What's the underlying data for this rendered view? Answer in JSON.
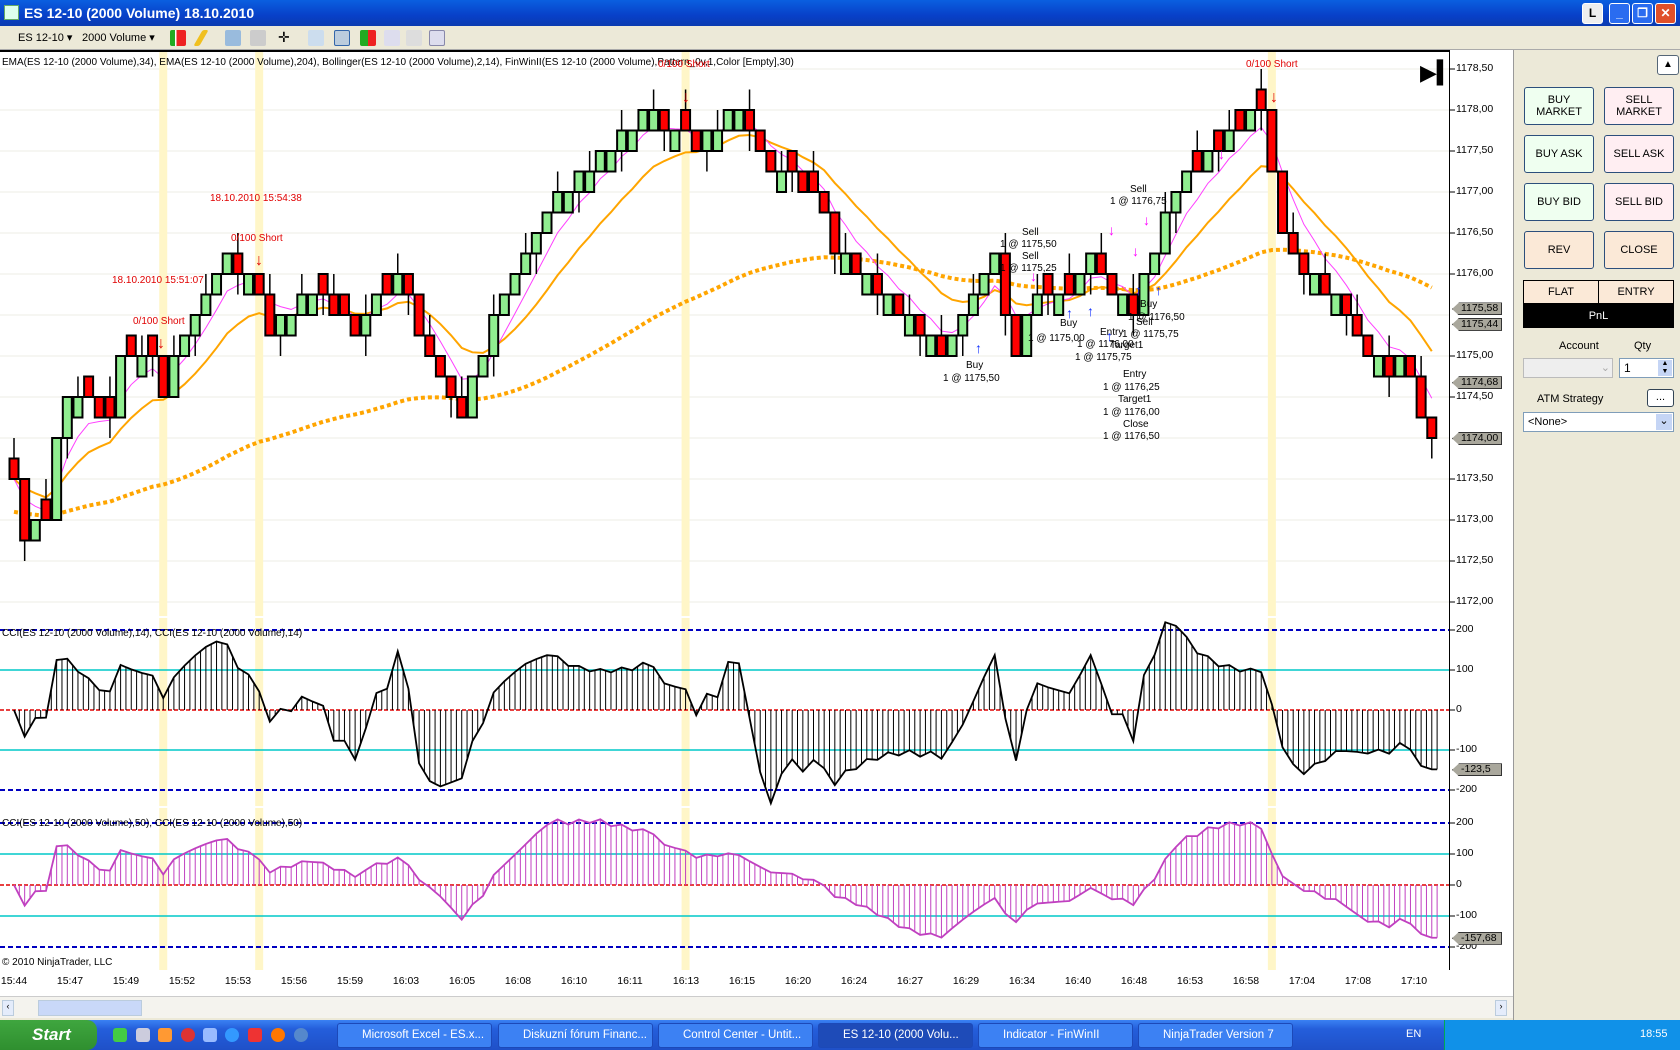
{
  "window": {
    "title": "ES 12-10 (2000 Volume)  18.10.2010",
    "min": "_",
    "restore": "❐",
    "close": "✕",
    "extra": "L"
  },
  "toolbar": {
    "instrument": "ES 12-10",
    "period": "2000 Volume"
  },
  "chart": {
    "indicator_label": "EMA(ES 12-10 (2000 Volume),34), EMA(ES 12-10 (2000 Volume),204), Bollinger(ES 12-10 (2000 Volume),2,14), FinWinII(ES 12-10 (2000 Volume),Pattern_0v,1,Color [Empty],30)",
    "cci1_label": "CCI(ES 12-10 (2000 Volume),14), CCI(ES 12-10 (2000 Volume),14)",
    "cci2_label": "CCI(ES 12-10 (2000 Volume),50), CCI(ES 12-10 (2000 Volume),50)",
    "copyright": "© 2010 NinjaTrader, LLC",
    "price_ticks": [
      "1178,50",
      "1178,00",
      "1177,50",
      "1177,00",
      "1176,50",
      "1176,00",
      "1175,00",
      "1174,50",
      "1173,50",
      "1173,00",
      "1172,50",
      "1172,00"
    ],
    "price_tags": [
      "1175,58",
      "1175,44",
      "1174,68",
      "1174,00"
    ],
    "cci1_ticks": [
      "200",
      "100",
      "0",
      "-100",
      "-200"
    ],
    "cci1_tag": "-123,5",
    "cci2_ticks": [
      "200",
      "100",
      "0",
      "-100",
      "-200"
    ],
    "cci2_tag": "-157,68",
    "time_ticks": [
      "15:44",
      "15:47",
      "15:49",
      "15:52",
      "15:53",
      "15:56",
      "15:59",
      "16:03",
      "16:05",
      "16:08",
      "16:10",
      "16:11",
      "16:13",
      "16:15",
      "16:20",
      "16:24",
      "16:27",
      "16:29",
      "16:34",
      "16:40",
      "16:48",
      "16:53",
      "16:58",
      "17:04",
      "17:08",
      "17:10"
    ],
    "signals": [
      "18.10.2010 15:54:38",
      "0/100 Short",
      "18.10.2010 15:51:07",
      "0/100 Short",
      "0/100 Short",
      "0/100 Short"
    ],
    "trades": [
      "Buy",
      "1 @ 1175,50",
      "Sell",
      "1 @ 1175,50",
      "Sell",
      "1 @ 1175,25",
      "Buy",
      "1 @ 1175,00",
      "Entry",
      "1 @ 1176,00",
      "Target1",
      "1 @ 1175,75",
      "Entry",
      "1 @ 1176,25",
      "Target1",
      "1 @ 1176,00",
      "Close",
      "1 @ 1176,50",
      "Buy",
      "1 @ 1176,50",
      "Sell",
      "1 @ 1175,75",
      "Sell",
      "1 @ 1176,75"
    ]
  },
  "chart_data": {
    "type": "candlestick",
    "price_path": [
      [
        0,
        1173.5
      ],
      [
        1,
        1172.75
      ],
      [
        3,
        1173.0
      ],
      [
        4,
        1174.0
      ],
      [
        5,
        1174.5
      ],
      [
        9,
        1174.25
      ],
      [
        10,
        1175.0
      ],
      [
        13,
        1175.0
      ],
      [
        14,
        1174.5
      ],
      [
        15,
        1175.0
      ],
      [
        18,
        1175.75
      ],
      [
        20,
        1176.25
      ],
      [
        23,
        1175.75
      ],
      [
        24,
        1175.25
      ],
      [
        28,
        1175.75
      ],
      [
        32,
        1175.25
      ],
      [
        36,
        1176.0
      ],
      [
        38,
        1175.25
      ],
      [
        41,
        1174.5
      ],
      [
        42,
        1174.25
      ],
      [
        43,
        1174.75
      ],
      [
        46,
        1175.75
      ],
      [
        49,
        1176.5
      ],
      [
        53,
        1177.25
      ],
      [
        58,
        1177.75
      ],
      [
        59,
        1178.0
      ],
      [
        61,
        1177.75
      ],
      [
        63,
        1177.75
      ],
      [
        64,
        1177.5
      ],
      [
        68,
        1178.0
      ],
      [
        69,
        1177.75
      ],
      [
        71,
        1177.25
      ],
      [
        75,
        1177.0
      ],
      [
        77,
        1176.25
      ],
      [
        81,
        1175.75
      ],
      [
        85,
        1175.25
      ],
      [
        87,
        1175.0
      ],
      [
        89,
        1175.5
      ],
      [
        92,
        1176.25
      ],
      [
        93,
        1175.5
      ],
      [
        94,
        1175.0
      ],
      [
        96,
        1175.75
      ],
      [
        99,
        1175.75
      ],
      [
        101,
        1176.25
      ],
      [
        103,
        1175.75
      ],
      [
        105,
        1175.5
      ],
      [
        107,
        1176.25
      ],
      [
        109,
        1177.0
      ],
      [
        111,
        1177.25
      ],
      [
        115,
        1177.75
      ],
      [
        117,
        1178.0
      ],
      [
        118,
        1177.25
      ],
      [
        119,
        1176.5
      ],
      [
        121,
        1176.0
      ],
      [
        125,
        1175.5
      ],
      [
        127,
        1175.0
      ],
      [
        129,
        1174.75
      ],
      [
        130,
        1175.0
      ],
      [
        133,
        1174.0
      ]
    ],
    "ylim": [
      1171.875,
      1178.6
    ],
    "colors": {
      "up": "#90ee90",
      "down": "#ff0000",
      "ema_fast": "#ff40ff",
      "ema34": "#ffa500",
      "ema204": "#ffa500",
      "cci2": "#c040c0"
    }
  },
  "panel": {
    "buy_market": "BUY MARKET",
    "sell_market": "SELL MARKET",
    "buy_ask": "BUY ASK",
    "sell_ask": "SELL ASK",
    "buy_bid": "BUY BID",
    "sell_bid": "SELL BID",
    "rev": "REV",
    "close": "CLOSE",
    "flat": "FLAT",
    "entry": "ENTRY",
    "pnl": "PnL",
    "account_label": "Account",
    "qty_label": "Qty",
    "qty": "1",
    "atm_label": "ATM Strategy",
    "atm_btn": "...",
    "atm_value": "<None>"
  },
  "taskbar": {
    "start": "Start",
    "tasks": [
      "Microsoft Excel - ES.x...",
      "Diskuzní fórum Financ...",
      "Control Center - Untit...",
      "ES 12-10 (2000 Volu...",
      "Indicator - FinWinII",
      "NinjaTrader Version 7"
    ],
    "lang": "EN",
    "clock": "18:55"
  }
}
